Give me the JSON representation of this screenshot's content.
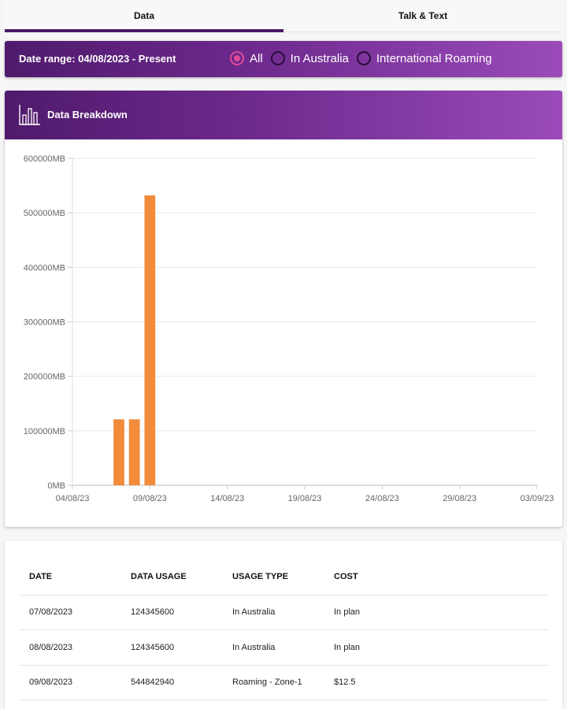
{
  "tabs": [
    {
      "label": "Data",
      "active": true
    },
    {
      "label": "Talk & Text",
      "active": false
    }
  ],
  "filter": {
    "date_range": "Date range: 04/08/2023 - Present",
    "options": [
      {
        "label": "All",
        "checked": true
      },
      {
        "label": "In Australia",
        "checked": false
      },
      {
        "label": "International Roaming",
        "checked": false
      }
    ]
  },
  "chart_header": {
    "title": "Data Breakdown",
    "icon": "bar-chart-icon"
  },
  "chart_data": {
    "type": "bar",
    "title": "",
    "xlabel": "",
    "ylabel": "",
    "unit_suffix": "MB",
    "ylim": [
      0,
      600000
    ],
    "y_ticks": [
      "0MB",
      "100000MB",
      "200000MB",
      "300000MB",
      "400000MB",
      "500000MB",
      "600000MB"
    ],
    "x_ticks": [
      "04/08/23",
      "09/08/23",
      "14/08/23",
      "19/08/23",
      "24/08/23",
      "29/08/23",
      "03/09/23"
    ],
    "x_start_date": "04/08/23",
    "x_end_date": "03/09/23",
    "bars": [
      {
        "date": "07/08/23",
        "value": 121000
      },
      {
        "date": "08/08/23",
        "value": 121000
      },
      {
        "date": "09/08/23",
        "value": 532000
      }
    ],
    "bar_color": "#f28b3a",
    "grid": true
  },
  "table": {
    "headers": [
      "DATE",
      "DATA USAGE",
      "USAGE TYPE",
      "COST"
    ],
    "rows": [
      [
        "07/08/2023",
        "124345600",
        "In Australia",
        "In plan"
      ],
      [
        "08/08/2023",
        "124345600",
        "In Australia",
        "In plan"
      ],
      [
        "09/08/2023",
        "544842940",
        "Roaming - Zone-1",
        "$12.5"
      ]
    ]
  }
}
